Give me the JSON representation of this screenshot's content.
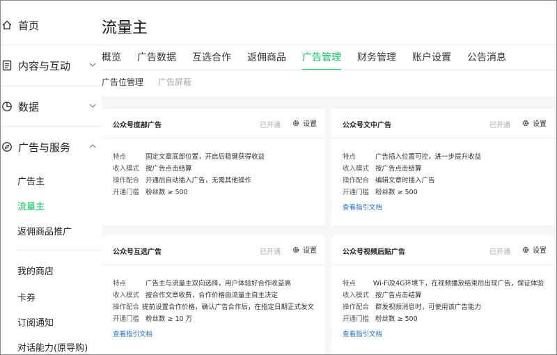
{
  "sidebar": {
    "home": "首页",
    "content": "内容与互动",
    "data": "数据",
    "ads": "广告与服务",
    "ads_items": [
      "广告主",
      "流量主",
      "返佣商品推广"
    ],
    "other_items": [
      "我的商店",
      "卡券",
      "订阅通知",
      "对话能力(原导购)"
    ]
  },
  "page": {
    "title": "流量主"
  },
  "tabs": [
    "概览",
    "广告数据",
    "互选合作",
    "返佣商品",
    "广告管理",
    "财务管理",
    "账户设置",
    "公告消息"
  ],
  "subtabs": [
    "广告位管理",
    "广告屏蔽"
  ],
  "setting_label": "设置",
  "accent_color": "#07c160",
  "cards": [
    {
      "title": "公众号底部广告",
      "status": "已开通",
      "rows": [
        {
          "k": "特点",
          "v": "固定文章底部位置，开启后稳健获得收益"
        },
        {
          "k": "收入模式",
          "v": "按广告点击结算"
        },
        {
          "k": "操作配合",
          "v": "开通后自动插入广告，无需其他操作"
        },
        {
          "k": "开通门槛",
          "v": "粉丝数 ≥ 500"
        }
      ],
      "link": ""
    },
    {
      "title": "公众号文中广告",
      "status": "已开通",
      "rows": [
        {
          "k": "特点",
          "v": "广告插入位置可控，进一步提升收益"
        },
        {
          "k": "收入模式",
          "v": "按广告点击结算"
        },
        {
          "k": "操作配合",
          "v": "编辑文章时插入广告"
        },
        {
          "k": "开通门槛",
          "v": "粉丝数 ≥ 500"
        }
      ],
      "link": "查看指引文档"
    },
    {
      "title": "公众号互选广告",
      "status": "已开通",
      "rows": [
        {
          "k": "特点",
          "v": "广告主与流量主双向选择，用户体验好合作收益高"
        },
        {
          "k": "收入模式",
          "v": "按合作文章收费，合作价格由流量主自主决定"
        },
        {
          "k": "操作配合",
          "v": "提前设置合作价格，确认广告合作后，在指定日期正式发文"
        },
        {
          "k": "开通门槛",
          "v": "粉丝数 ≥ 10 万"
        }
      ],
      "link": "查看指引文档"
    },
    {
      "title": "公众号视频后贴广告",
      "status": "已开通",
      "rows": [
        {
          "k": "特点",
          "v": "Wi-Fi及4G环境下，在视频播放结束后出现广告，保证体验"
        },
        {
          "k": "收入模式",
          "v": "按广告点击结算"
        },
        {
          "k": "操作配合",
          "v": "群发视频消息时，可使用该广告能力"
        },
        {
          "k": "开通门槛",
          "v": "粉丝数 ≥ 500"
        }
      ],
      "link": "查看指引文档"
    }
  ]
}
